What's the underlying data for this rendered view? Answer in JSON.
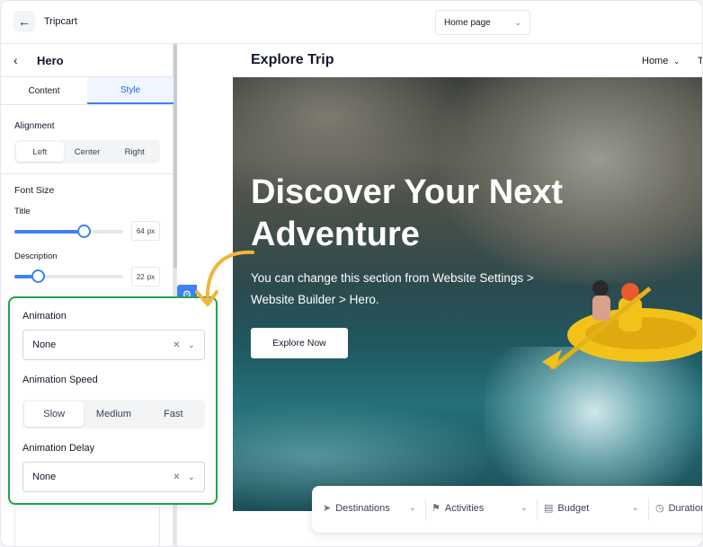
{
  "app": {
    "title": "Tripcart",
    "back_icon": "arrow-left-icon"
  },
  "page_select": {
    "value": "Home page"
  },
  "panel": {
    "title": "Hero",
    "tabs": [
      {
        "label": "Content"
      },
      {
        "label": "Style"
      }
    ],
    "alignment": {
      "label": "Alignment",
      "options": [
        "Left",
        "Center",
        "Right"
      ],
      "selected": "Left"
    },
    "font_size": {
      "heading": "Font Size",
      "title": {
        "label": "Title",
        "value": "64",
        "unit": "px",
        "fraction": 0.64
      },
      "description": {
        "label": "Description",
        "value": "22",
        "unit": "px",
        "fraction": 0.22
      }
    }
  },
  "animation": {
    "animation_label": "Animation",
    "animation_value": "None",
    "speed_label": "Animation Speed",
    "speed_options": [
      "Slow",
      "Medium",
      "Fast"
    ],
    "speed_selected": "Slow",
    "delay_label": "Animation Delay",
    "delay_value": "None"
  },
  "preview": {
    "brand": "Explore Trip",
    "nav": {
      "home": "Home",
      "truncated": "T"
    },
    "hero": {
      "title": "Discover Your Next Adventure",
      "subtitle": "You can change this section from Website Settings > Website Builder > Hero.",
      "button": "Explore Now"
    },
    "search": {
      "destinations": "Destinations",
      "activities": "Activities",
      "budget": "Budget",
      "duration": "Duration"
    }
  },
  "colors": {
    "accent": "#3b82f6",
    "highlight_border": "#22a447",
    "arrow": "#f2b53a"
  }
}
